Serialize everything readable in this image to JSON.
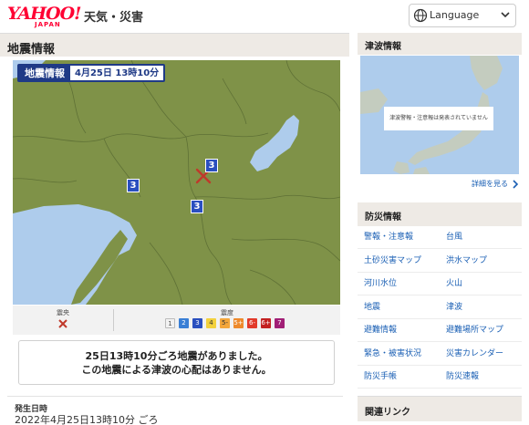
{
  "header": {
    "logo_main": "YAHOO!",
    "logo_sub": "JAPAN",
    "service": "天気・災害",
    "language_label": "Language"
  },
  "quake": {
    "section_title": "地震情報",
    "map_label_title": "地震情報",
    "map_label_time": "4月25日 13時10分",
    "intensity_markers": [
      "3",
      "3",
      "3"
    ],
    "legend": {
      "epicenter_label": "震央",
      "intensity_label": "震度",
      "levels": [
        {
          "label": "1",
          "color": "#f2f2f2",
          "text": "#555"
        },
        {
          "label": "2",
          "color": "#3a7fd5",
          "text": "#fff"
        },
        {
          "label": "3",
          "color": "#2a4fbf",
          "text": "#fff"
        },
        {
          "label": "4",
          "color": "#f3d13d",
          "text": "#333"
        },
        {
          "label": "5-",
          "color": "#f4a63b",
          "text": "#333"
        },
        {
          "label": "5+",
          "color": "#ee8a2c",
          "text": "#fff"
        },
        {
          "label": "6-",
          "color": "#e23a2a",
          "text": "#fff"
        },
        {
          "label": "6+",
          "color": "#c32121",
          "text": "#fff"
        },
        {
          "label": "7",
          "color": "#a11f76",
          "text": "#fff"
        }
      ]
    },
    "notice_line1": "25日13時10分ごろ地震がありました。",
    "notice_line2": "この地震による津波の心配はありません。",
    "occurrence_label": "発生日時",
    "occurrence_value": "2022年4月25日13時10分 ごろ"
  },
  "tsunami": {
    "section_title": "津波情報",
    "status_message": "津波警報・注意報は発表されていません",
    "more_link": "詳細を見る"
  },
  "bousai": {
    "section_title": "防災情報",
    "items": [
      "警報・注意報",
      "台風",
      "土砂災害マップ",
      "洪水マップ",
      "河川水位",
      "火山",
      "地震",
      "津波",
      "避難情報",
      "避難場所マップ",
      "緊急・被害状況",
      "災害カレンダー",
      "防災手帳",
      "防災速報"
    ]
  },
  "kanren": {
    "section_title": "関連リンク"
  },
  "colors": {
    "land": "#7f9248",
    "sea": "#aeccec",
    "accent_navy": "#1f3a86",
    "link_blue": "#1a5fb4",
    "yahoo_red": "#ff0033"
  }
}
